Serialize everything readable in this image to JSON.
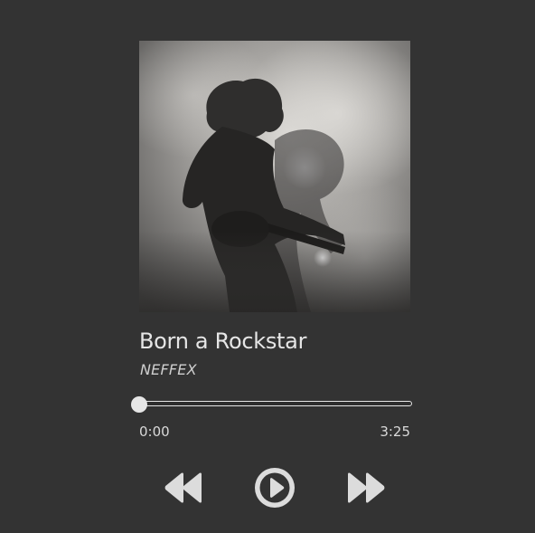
{
  "track": {
    "title": "Born a Rockstar",
    "artist": "NEFFEX",
    "album_art_alt": "Album cover"
  },
  "progress": {
    "current_time": "0:00",
    "total_time": "3:25",
    "fraction": 0.0
  },
  "controls": {
    "prev_icon": "rewind-icon",
    "play_icon": "play-icon",
    "next_icon": "fast-forward-icon"
  },
  "colors": {
    "background": "#333333",
    "foreground": "#e6e6e6"
  }
}
